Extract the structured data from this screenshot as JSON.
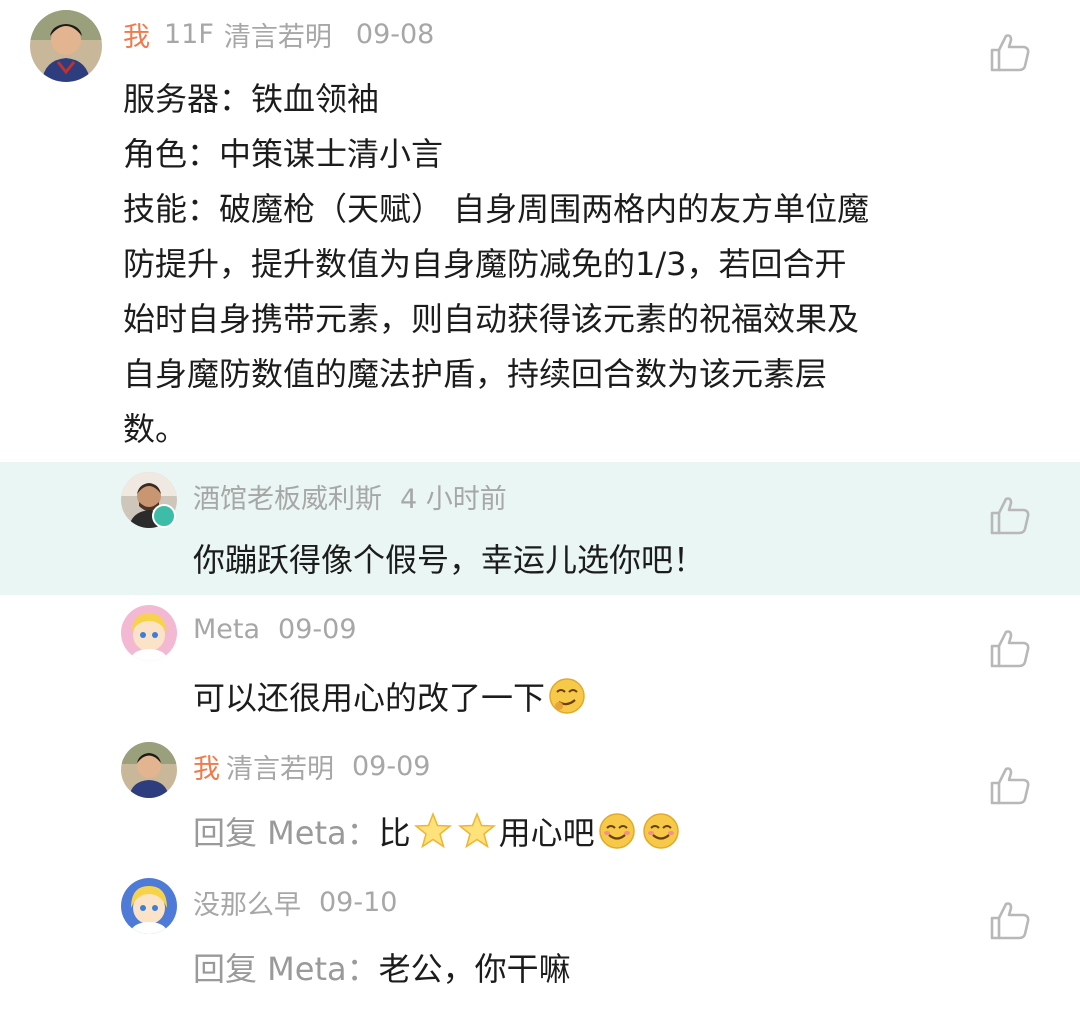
{
  "main_comment": {
    "me_tag": "我",
    "floor": "11F",
    "nickname": "清言若明",
    "date": "09-08",
    "lines": [
      "服务器：铁血领袖",
      "角色：中策谋士清小言",
      "技能：破魔枪（天赋） 自身周围两格内的友方单位魔",
      "防提升，提升数值为自身魔防减免的1/3，若回合开",
      "始时自身携带元素，则自动获得该元素的祝福效果及",
      "自身魔防数值的魔法护盾，持续回合数为该元素层",
      "数。"
    ]
  },
  "replies": [
    {
      "name": "酒馆老板威利斯",
      "time": "4 小时前",
      "text": "你蹦跃得像个假号，幸运儿选你吧！",
      "highlight": true
    },
    {
      "name": "Meta",
      "time": "09-09",
      "text": "可以还很用心的改了一下"
    },
    {
      "me_tag": "我",
      "name": "清言若明",
      "time": "09-09",
      "reply_prefix": "回复 Meta：",
      "text_a": "比",
      "text_b": "用心吧"
    },
    {
      "name": "没那么早",
      "time": "09-10",
      "reply_prefix": "回复 Meta：",
      "text": "老公，你干嘛"
    }
  ],
  "icons": {
    "like": "thumbs-up-icon",
    "verified": "verified-badge-icon"
  },
  "colors": {
    "me_tag": "#f07a4c",
    "meta_text": "#a7a7a7",
    "highlight_bg": "#eaf6f4"
  }
}
